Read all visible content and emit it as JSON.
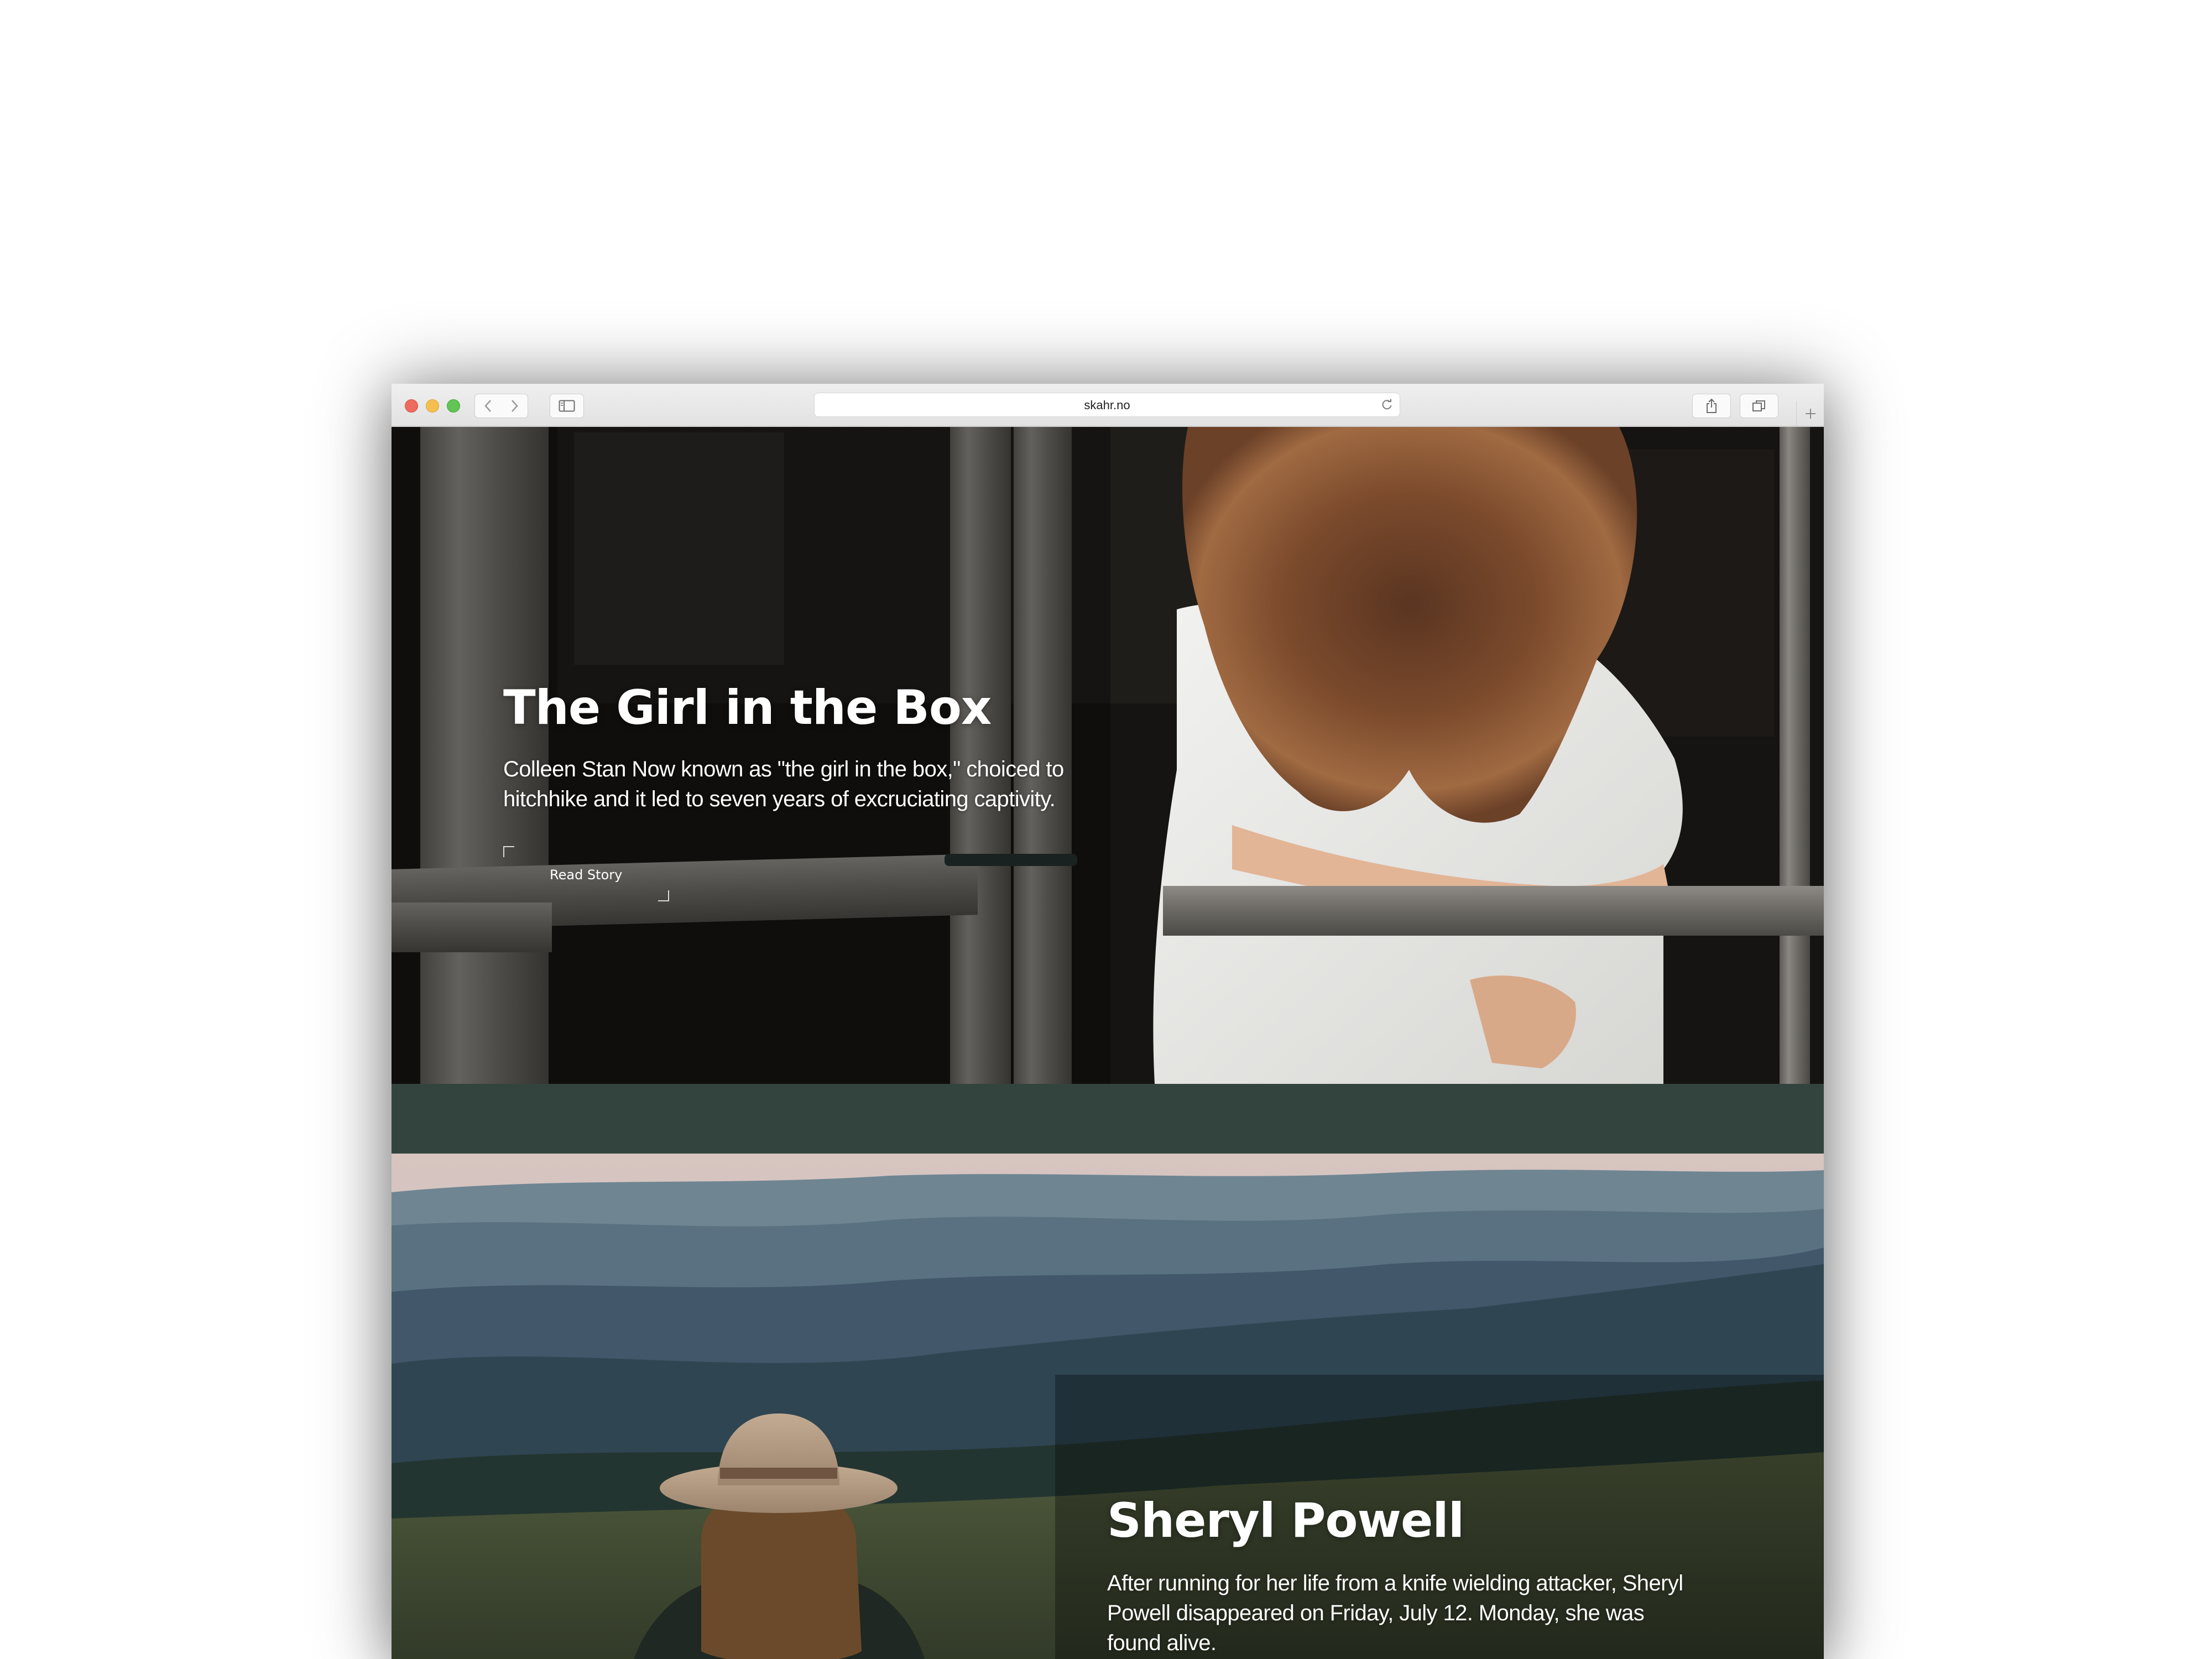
{
  "browser": {
    "url": "skahr.no",
    "icons": {
      "back": "chevron-left-icon",
      "forward": "chevron-right-icon",
      "sidebar": "sidebar-icon",
      "reload": "reload-icon",
      "share": "share-icon",
      "tabs": "tabs-overview-icon",
      "new_tab": "plus-icon"
    }
  },
  "stories": [
    {
      "title": "The Girl in the Box",
      "description": "Colleen Stan Now known as \"the girl in the box,\" choiced to hitchhike and it led to seven years of excruciating captivity.",
      "cta": "Read Story"
    },
    {
      "title": "Sheryl Powell",
      "description": "After running for her life from a knife wielding attacker, Sheryl Powell disappeared on Friday, July 12. Monday, she was found alive."
    }
  ],
  "colors": {
    "band": "#33443e",
    "text": "#ffffff"
  }
}
